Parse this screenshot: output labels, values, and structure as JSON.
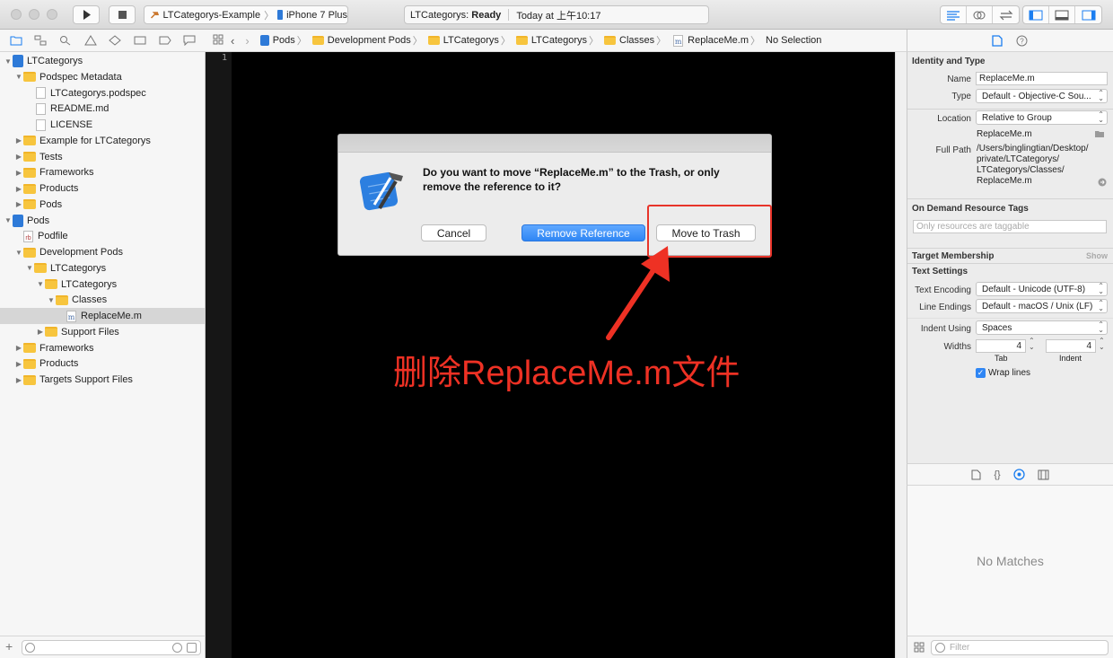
{
  "toolbar": {
    "scheme_name": "LTCategorys-Example",
    "device_name": "iPhone 7 Plus",
    "status_project": "LTCategorys:",
    "status_state": "Ready",
    "status_time": "Today at 上午10:17"
  },
  "navigator": {
    "items": [
      {
        "label": "LTCategorys",
        "icon": "project",
        "indent": 0,
        "expanded": true
      },
      {
        "label": "Podspec Metadata",
        "icon": "folder",
        "indent": 1,
        "expanded": true
      },
      {
        "label": "LTCategorys.podspec",
        "icon": "file",
        "indent": 2
      },
      {
        "label": "README.md",
        "icon": "file",
        "indent": 2
      },
      {
        "label": "LICENSE",
        "icon": "file",
        "indent": 2
      },
      {
        "label": "Example for LTCategorys",
        "icon": "folder",
        "indent": 1,
        "expanded": false
      },
      {
        "label": "Tests",
        "icon": "folder",
        "indent": 1,
        "expanded": false
      },
      {
        "label": "Frameworks",
        "icon": "folder",
        "indent": 1,
        "expanded": false
      },
      {
        "label": "Products",
        "icon": "folder",
        "indent": 1,
        "expanded": false
      },
      {
        "label": "Pods",
        "icon": "folder",
        "indent": 1,
        "expanded": false
      },
      {
        "label": "Pods",
        "icon": "project",
        "indent": 0,
        "expanded": true
      },
      {
        "label": "Podfile",
        "icon": "rb-file",
        "indent": 1
      },
      {
        "label": "Development Pods",
        "icon": "folder",
        "indent": 1,
        "expanded": true
      },
      {
        "label": "LTCategorys",
        "icon": "folder",
        "indent": 2,
        "expanded": true
      },
      {
        "label": "LTCategorys",
        "icon": "folder",
        "indent": 3,
        "expanded": true
      },
      {
        "label": "Classes",
        "icon": "folder",
        "indent": 4,
        "expanded": true
      },
      {
        "label": "ReplaceMe.m",
        "icon": "m-file",
        "indent": 5,
        "selected": true
      },
      {
        "label": "Support Files",
        "icon": "folder",
        "indent": 3,
        "expanded": false
      },
      {
        "label": "Frameworks",
        "icon": "folder",
        "indent": 1,
        "expanded": false
      },
      {
        "label": "Products",
        "icon": "folder",
        "indent": 1,
        "expanded": false
      },
      {
        "label": "Targets Support Files",
        "icon": "folder",
        "indent": 1,
        "expanded": false
      }
    ]
  },
  "jumpbar": {
    "crumbs": [
      "Pods",
      "Development Pods",
      "LTCategorys",
      "LTCategorys",
      "Classes",
      "ReplaceMe.m"
    ],
    "last": "No Selection"
  },
  "editor": {
    "line_number": "1"
  },
  "alert": {
    "message": "Do you want to move “ReplaceMe.m” to the Trash, or only remove the reference to it?",
    "cancel_label": "Cancel",
    "remove_label": "Remove Reference",
    "trash_label": "Move to Trash"
  },
  "annotation": {
    "text": "删除ReplaceMe.m文件",
    "color": "#ee3124"
  },
  "inspector": {
    "identity_title": "Identity and Type",
    "name_label": "Name",
    "name_value": "ReplaceMe.m",
    "type_label": "Type",
    "type_value": "Default - Objective-C Sou...",
    "location_label": "Location",
    "location_value": "Relative to Group",
    "location_file": "ReplaceMe.m",
    "fullpath_label": "Full Path",
    "fullpath_lines": [
      "/Users/binglingtian/Desktop/",
      "private/LTCategorys/",
      "LTCategorys/Classes/",
      "ReplaceMe.m"
    ],
    "ondemand_title": "On Demand Resource Tags",
    "ondemand_placeholder": "Only resources are taggable",
    "target_title": "Target Membership",
    "target_show": "Show",
    "text_settings_title": "Text Settings",
    "encoding_label": "Text Encoding",
    "encoding_value": "Default - Unicode (UTF-8)",
    "endings_label": "Line Endings",
    "endings_value": "Default - macOS / Unix (LF)",
    "indent_using_label": "Indent Using",
    "indent_using_value": "Spaces",
    "widths_label": "Widths",
    "tab_value": "4",
    "indent_value": "4",
    "tab_caption": "Tab",
    "indent_caption": "Indent",
    "wrap_label": "Wrap lines"
  },
  "library": {
    "empty_text": "No Matches",
    "filter_placeholder": "Filter"
  },
  "colors": {
    "accent": "#2f86f4",
    "folder": "#f7c53e",
    "highlight": "#e8342a"
  }
}
